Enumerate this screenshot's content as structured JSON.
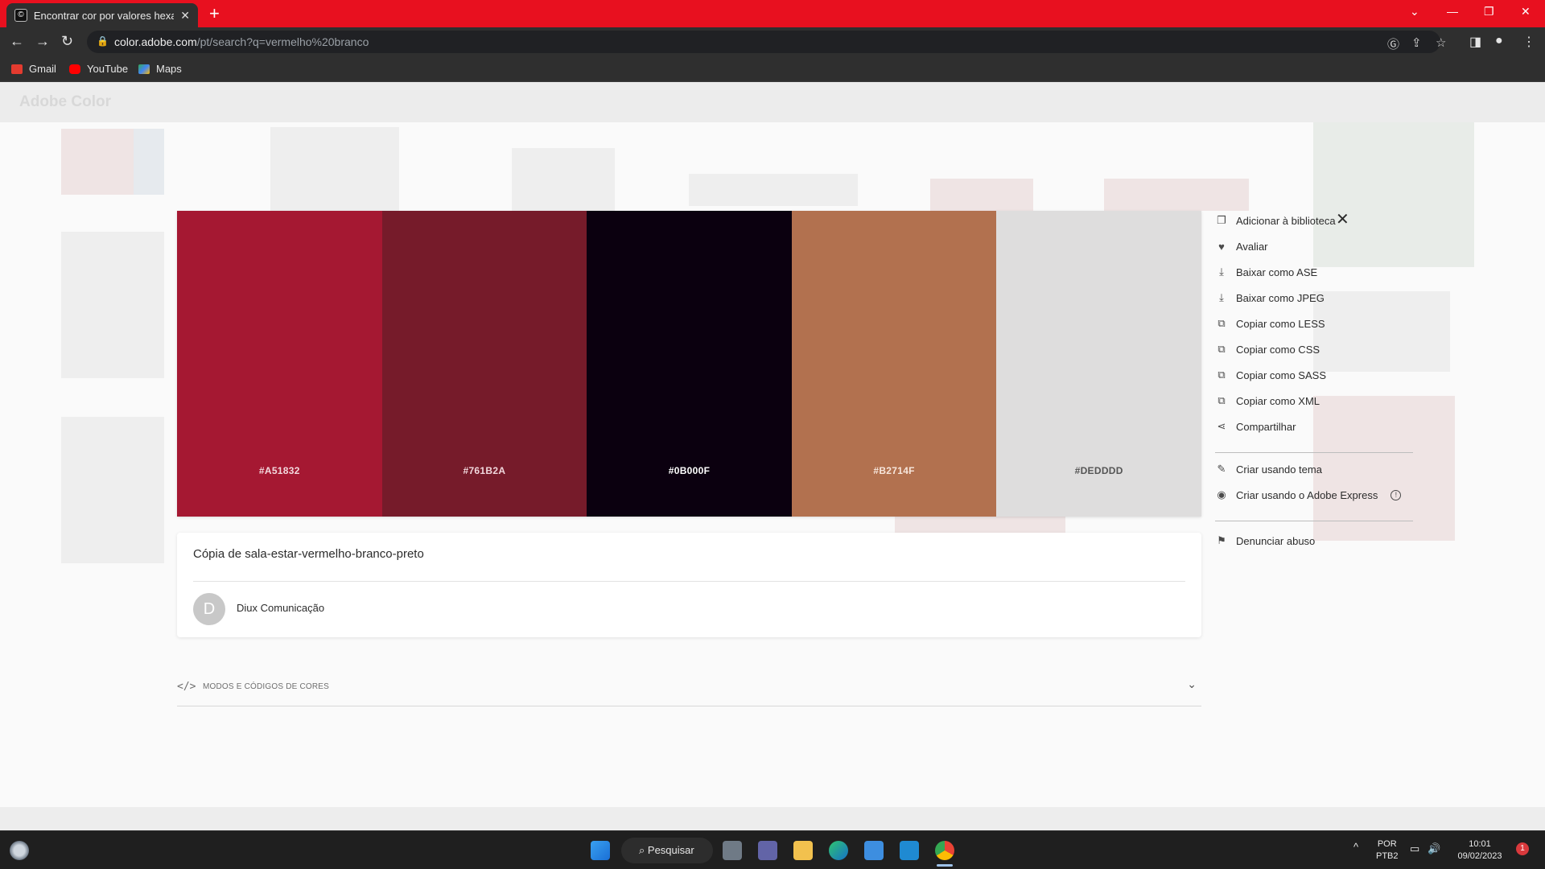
{
  "browser": {
    "tab_title": "Encontrar cor por valores hexade",
    "url_host": "color.adobe.com",
    "url_path": "/pt/search?q=vermelho%20branco",
    "bookmarks": [
      "Gmail",
      "YouTube",
      "Maps"
    ]
  },
  "app": {
    "brand": "Adobe Color"
  },
  "palette": {
    "swatches": [
      {
        "hex": "#A51832",
        "color": "#A51832",
        "text_color": "#f3d9de"
      },
      {
        "hex": "#761B2A",
        "color": "#761B2A",
        "text_color": "#f0d7dc"
      },
      {
        "hex": "#0B000F",
        "color": "#0B000F",
        "text_color": "#ffffff"
      },
      {
        "hex": "#B2714F",
        "color": "#B2714F",
        "text_color": "#f7e6dc"
      },
      {
        "hex": "#DEDDDD",
        "color": "#DEDDDD",
        "text_color": "#555555"
      }
    ]
  },
  "theme": {
    "title": "Cópia de sala-estar-vermelho-branco-preto",
    "author_initial": "D",
    "author_name": "Diux Comunicação"
  },
  "modes_section": {
    "icon": "</>",
    "label": "MODOS E CÓDIGOS DE CORES"
  },
  "side_menu": {
    "group1": [
      {
        "label": "Adicionar à biblioteca",
        "icon": "library-icon"
      },
      {
        "label": "Avaliar",
        "icon": "heart-icon"
      },
      {
        "label": "Baixar como ASE",
        "icon": "download-icon"
      },
      {
        "label": "Baixar como JPEG",
        "icon": "download-icon"
      },
      {
        "label": "Copiar como LESS",
        "icon": "copy-icon"
      },
      {
        "label": "Copiar como CSS",
        "icon": "copy-icon"
      },
      {
        "label": "Copiar como SASS",
        "icon": "copy-icon"
      },
      {
        "label": "Copiar como XML",
        "icon": "copy-icon"
      },
      {
        "label": "Compartilhar",
        "icon": "share-icon"
      }
    ],
    "group2": [
      {
        "label": "Criar usando tema",
        "icon": "brush-icon"
      },
      {
        "label": "Criar usando o Adobe Express",
        "icon": "express-icon"
      }
    ],
    "group3": [
      {
        "label": "Denunciar abuso",
        "icon": "flag-icon"
      }
    ]
  },
  "taskbar": {
    "search_label": "Pesquisar",
    "lang_top": "POR",
    "lang_bottom": "PTB2",
    "time": "10:01",
    "date": "09/02/2023",
    "notification_count": "1"
  }
}
